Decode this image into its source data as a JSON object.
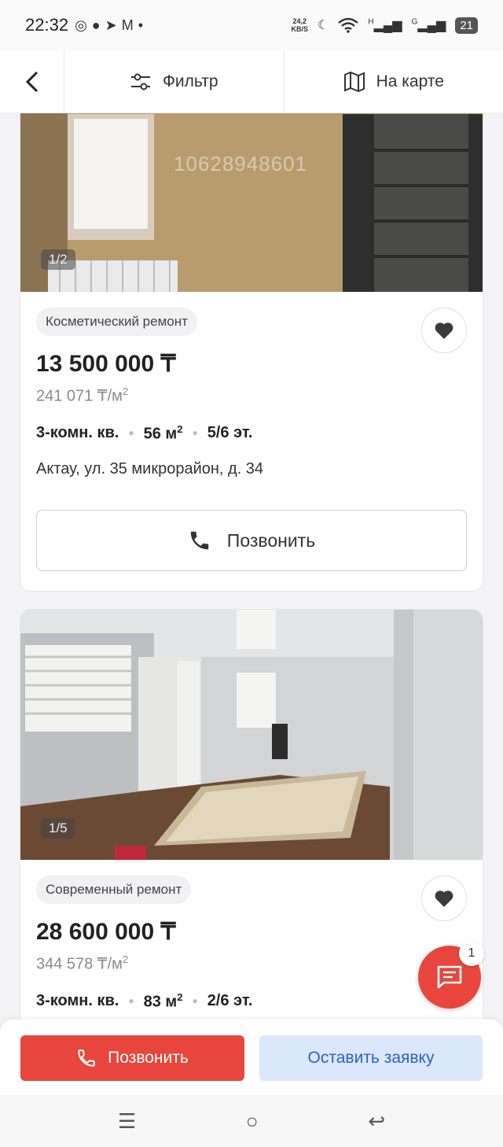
{
  "status": {
    "time": "22:32",
    "speed_top": "24,2",
    "speed_bottom": "KB/S",
    "signal1_label": "H",
    "signal2_label": "G",
    "battery": "21"
  },
  "toolbar": {
    "filter_label": "Фильтр",
    "map_label": "На карте"
  },
  "listings": [
    {
      "photo_counter": "1/2",
      "watermark": "10628948601",
      "tag": "Косметический ремонт",
      "price": "13 500 000 ₸",
      "price_per_m": "241 071 ₸/м",
      "rooms": "3-комн. кв.",
      "area": "56 м",
      "floor": "5/6 эт.",
      "address": "Актау, ул. 35 микрорайон, д. 34",
      "call_label": "Позвонить"
    },
    {
      "photo_counter": "1/5",
      "tag": "Современный ремонт",
      "price": "28 600 000 ₸",
      "price_per_m": "344 578 ₸/м",
      "rooms": "3-комн. кв.",
      "area": "83 м",
      "floor": "2/6 эт."
    }
  ],
  "sq_sup": "2",
  "chat": {
    "badge": "1"
  },
  "actions": {
    "call_label": "Позвонить",
    "request_label": "Оставить заявку"
  },
  "colors": {
    "accent_red": "#e8463c",
    "request_bg": "#dbe8fb",
    "request_text": "#2a62c9"
  }
}
